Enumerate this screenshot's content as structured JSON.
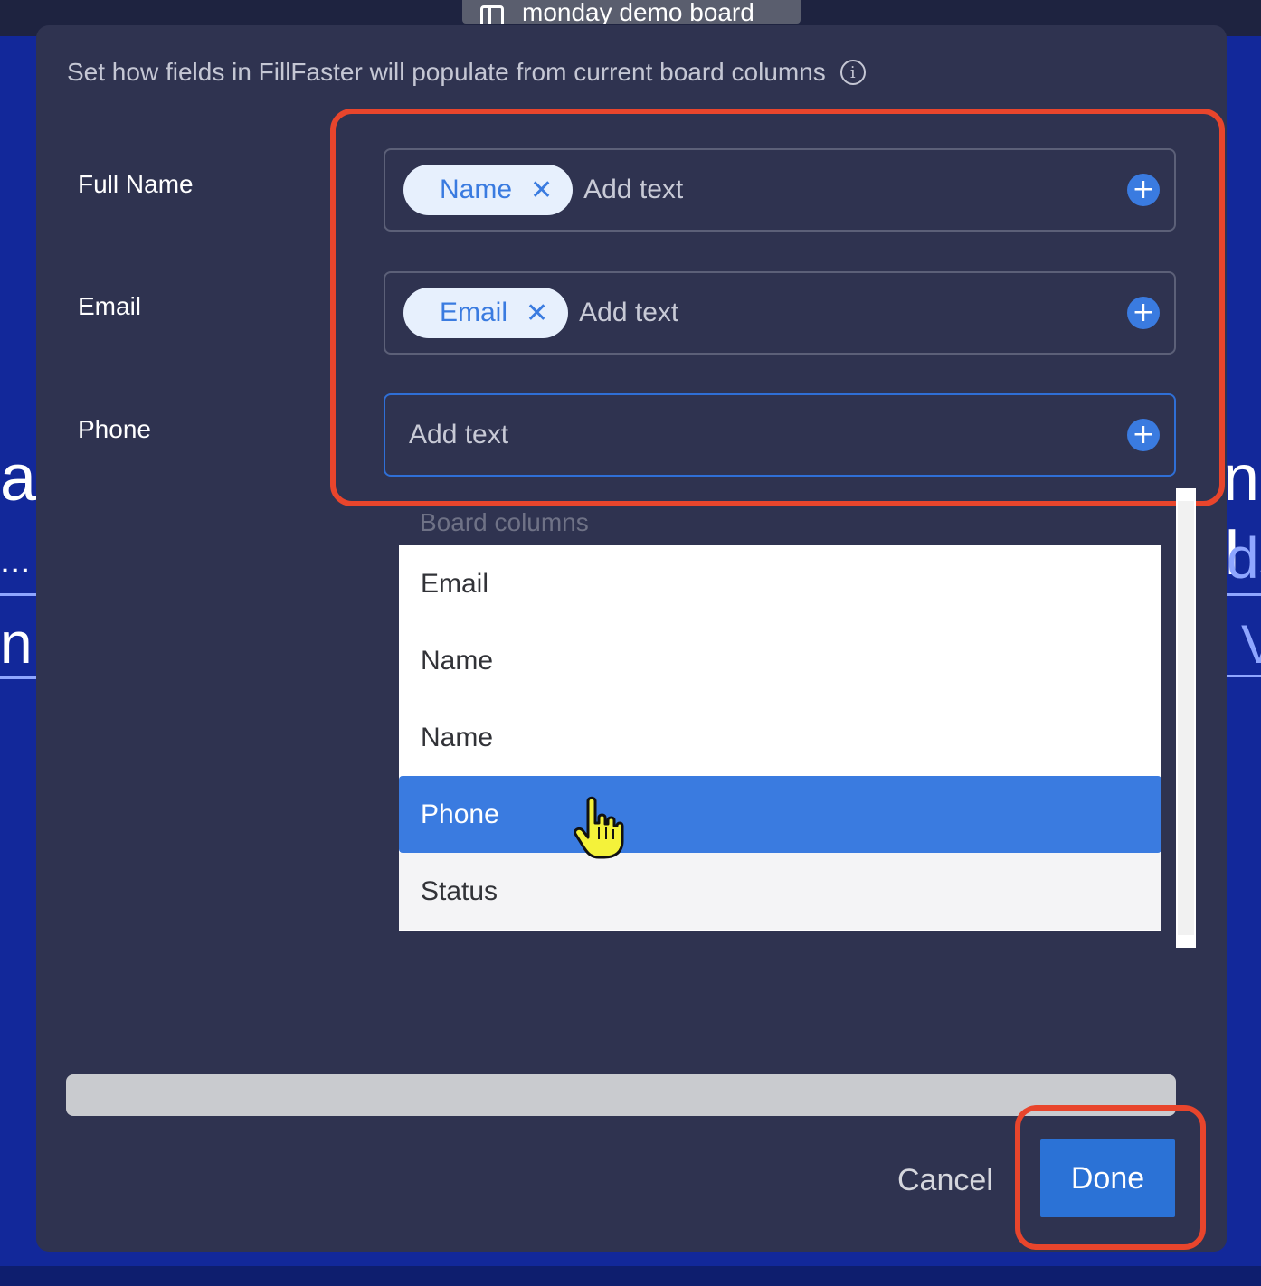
{
  "window_tab": {
    "title": "monday demo board",
    "icon": "board-icon"
  },
  "background": {
    "fragments": [
      "ar",
      "...",
      "n",
      "n I",
      "ds",
      "V"
    ]
  },
  "dialog": {
    "subtitle": "Set how fields in FillFaster will populate from current board columns",
    "info_icon": "i",
    "fields": [
      {
        "label": "Full Name",
        "chip": "Name",
        "placeholder": "Add text"
      },
      {
        "label": "Email",
        "chip": "Email",
        "placeholder": "Add text"
      },
      {
        "label": "Phone",
        "placeholder": "Add text"
      }
    ],
    "chip_remove": "✕",
    "add_icon": "+",
    "dropdown": {
      "header": "Board columns",
      "items": [
        "Email",
        "Name",
        "Name",
        "Phone",
        "Status"
      ],
      "selected": "Phone"
    },
    "cancel_label": "Cancel",
    "done_label": "Done"
  },
  "colors": {
    "accent": "#2b72d6",
    "highlight": "#e8452c",
    "dialog_bg": "#2f3350",
    "page_bg": "#12289a"
  }
}
